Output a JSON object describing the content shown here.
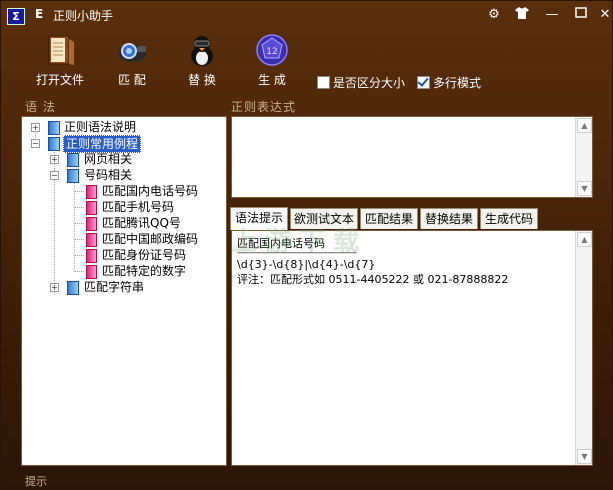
{
  "window": {
    "title": "正则小助手",
    "title_prefix": "E",
    "colors": {
      "frame": "#3e1f08",
      "selection": "#2a5cc8"
    }
  },
  "toolbar": {
    "buttons": [
      {
        "label": "打开文件",
        "icon": "open-file-icon"
      },
      {
        "label": "匹 配",
        "icon": "match-icon"
      },
      {
        "label": "替 换",
        "icon": "replace-icon"
      },
      {
        "label": "生 成",
        "icon": "generate-icon"
      }
    ],
    "options": [
      {
        "label": "是否区分大小",
        "checked": false
      },
      {
        "label": "多行模式",
        "checked": true
      }
    ]
  },
  "left_panel": {
    "title": "语 法"
  },
  "tree": [
    {
      "label": "正则语法说明",
      "level": 0,
      "expander": "+",
      "icon": "book"
    },
    {
      "label": "正则常用例程",
      "level": 0,
      "expander": "-",
      "icon": "book",
      "selected": true
    },
    {
      "label": "网页相关",
      "level": 1,
      "expander": "+",
      "icon": "book"
    },
    {
      "label": "号码相关",
      "level": 1,
      "expander": "-",
      "icon": "book"
    },
    {
      "label": "匹配国内电话号码",
      "level": 2,
      "icon": "doc"
    },
    {
      "label": "匹配手机号码",
      "level": 2,
      "icon": "doc"
    },
    {
      "label": "匹配腾讯QQ号",
      "level": 2,
      "icon": "doc"
    },
    {
      "label": "匹配中国邮政编码",
      "level": 2,
      "icon": "doc"
    },
    {
      "label": "匹配身份证号码",
      "level": 2,
      "icon": "doc"
    },
    {
      "label": "匹配特定的数字",
      "level": 2,
      "icon": "doc"
    },
    {
      "label": "匹配字符串",
      "level": 1,
      "expander": "+",
      "icon": "book"
    }
  ],
  "regex": {
    "title": "正则表达式",
    "value": ""
  },
  "tabs": [
    "语法提示",
    "欲测试文本",
    "匹配结果",
    "替换结果",
    "生成代码"
  ],
  "active_tab": 0,
  "content": {
    "lines": [
      "匹配国内电话号码",
      "-----------------------------------------------------",
      "\\d{3}-\\d{8}|\\d{4}-\\d{7}",
      "评注：匹配形式如 0511-4405222 或 021-87888822"
    ]
  },
  "watermark": "上游下载",
  "statusbar": {
    "text": "提示"
  }
}
